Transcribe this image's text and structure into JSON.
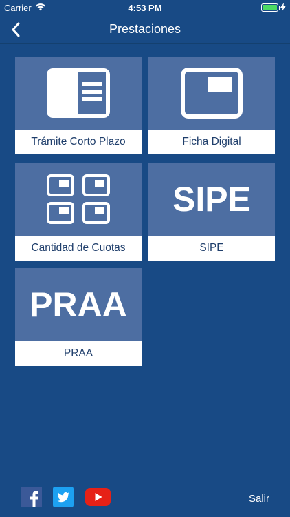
{
  "status_bar": {
    "carrier": "Carrier",
    "time": "4:53 PM"
  },
  "nav": {
    "title": "Prestaciones"
  },
  "tiles": [
    {
      "label": "Trámite Corto Plazo",
      "icon": "document-card-icon"
    },
    {
      "label": "Ficha Digital",
      "icon": "monitor-icon"
    },
    {
      "label": "Cantidad de Cuotas",
      "icon": "grid-cards-icon"
    },
    {
      "label": "SIPE",
      "icon_text": "SIPE"
    },
    {
      "label": "PRAA",
      "icon_text": "PRAA"
    }
  ],
  "footer": {
    "exit_label": "Salir"
  },
  "colors": {
    "background": "#184a85",
    "tile_top": "#4d6ea2",
    "tile_label_text": "#1f3e6b",
    "facebook": "#3b5998",
    "twitter": "#1da1f2",
    "youtube": "#e62117"
  }
}
